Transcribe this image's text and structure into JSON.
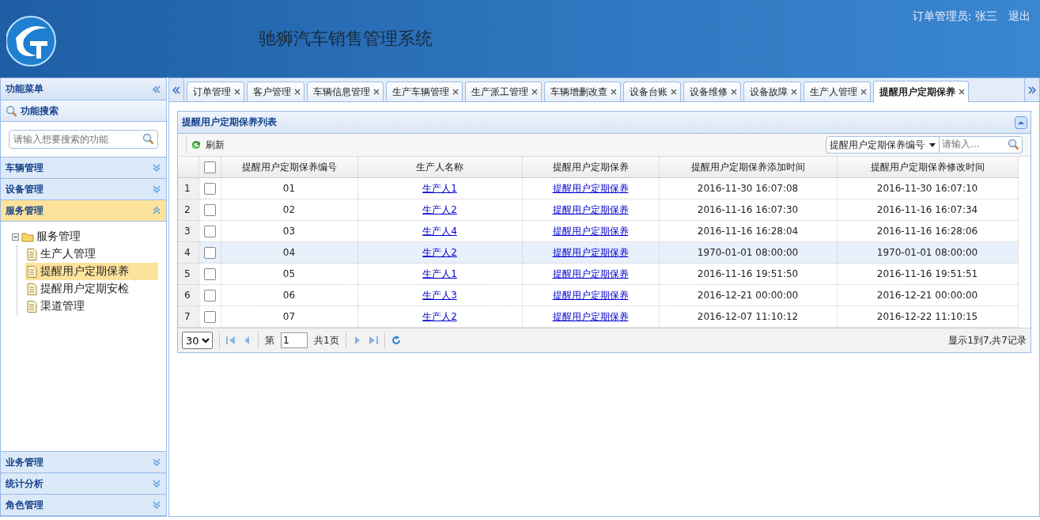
{
  "header": {
    "title": "驰狮汽车销售管理系统",
    "user": "订单管理员: 张三",
    "logout": "退出"
  },
  "sidebar": {
    "title": "功能菜单",
    "search_title": "功能搜索",
    "search": {
      "placeholder": "请输入想要搜索的功能"
    },
    "sections": [
      {
        "label": "车辆管理",
        "expanded": false
      },
      {
        "label": "设备管理",
        "expanded": false
      },
      {
        "label": "服务管理",
        "expanded": true,
        "tree": {
          "label": "服务管理",
          "expanded": true,
          "children": [
            {
              "label": "生产人管理",
              "selected": false
            },
            {
              "label": "提醒用户定期保养",
              "selected": true
            },
            {
              "label": "提醒用户定期安检",
              "selected": false
            },
            {
              "label": "渠道管理",
              "selected": false
            }
          ]
        }
      },
      {
        "label": "业务管理",
        "expanded": false
      },
      {
        "label": "统计分析",
        "expanded": false
      },
      {
        "label": "角色管理",
        "expanded": false
      }
    ]
  },
  "tabs": [
    {
      "label": "订单管理",
      "selected": false
    },
    {
      "label": "客户管理",
      "selected": false
    },
    {
      "label": "车辆信息管理",
      "selected": false
    },
    {
      "label": "生产车辆管理",
      "selected": false
    },
    {
      "label": "生产派工管理",
      "selected": false
    },
    {
      "label": "车辆增删改查",
      "selected": false
    },
    {
      "label": "设备台账",
      "selected": false
    },
    {
      "label": "设备维修",
      "selected": false
    },
    {
      "label": "设备故障",
      "selected": false
    },
    {
      "label": "生产人管理",
      "selected": false
    },
    {
      "label": "提醒用户定期保养",
      "selected": true
    }
  ],
  "panel": {
    "title": "提醒用户定期保养列表",
    "toolbar": {
      "refresh": "刷新",
      "search_field": "提醒用户定期保养编号",
      "search": {
        "placeholder": "请输入..."
      }
    },
    "table": {
      "columns": [
        {
          "label": "提醒用户定期保养编号",
          "kind": "text"
        },
        {
          "label": "生产人名称",
          "kind": "link"
        },
        {
          "label": "提醒用户定期保养",
          "kind": "link"
        },
        {
          "label": "提醒用户定期保养添加时间",
          "kind": "text"
        },
        {
          "label": "提醒用户定期保养修改时间",
          "kind": "text"
        }
      ],
      "header_checked": false,
      "rows": [
        {
          "number": "1",
          "selected": false,
          "checked": false,
          "cells": [
            "01",
            "生产人1",
            "提醒用户定期保养",
            "2016-11-30 16:07:08",
            "2016-11-30 16:07:10"
          ]
        },
        {
          "number": "2",
          "selected": false,
          "checked": false,
          "cells": [
            "02",
            "生产人2",
            "提醒用户定期保养",
            "2016-11-16 16:07:30",
            "2016-11-16 16:07:34"
          ]
        },
        {
          "number": "3",
          "selected": false,
          "checked": false,
          "cells": [
            "03",
            "生产人4",
            "提醒用户定期保养",
            "2016-11-16 16:28:04",
            "2016-11-16 16:28:06"
          ]
        },
        {
          "number": "4",
          "selected": true,
          "checked": false,
          "cells": [
            "04",
            "生产人2",
            "提醒用户定期保养",
            "1970-01-01 08:00:00",
            "1970-01-01 08:00:00"
          ]
        },
        {
          "number": "5",
          "selected": false,
          "checked": false,
          "cells": [
            "05",
            "生产人1",
            "提醒用户定期保养",
            "2016-11-16 19:51:50",
            "2016-11-16 19:51:51"
          ]
        },
        {
          "number": "6",
          "selected": false,
          "checked": false,
          "cells": [
            "06",
            "生产人3",
            "提醒用户定期保养",
            "2016-12-21 00:00:00",
            "2016-12-21 00:00:00"
          ]
        },
        {
          "number": "7",
          "selected": false,
          "checked": false,
          "cells": [
            "07",
            "生产人2",
            "提醒用户定期保养",
            "2016-12-07 11:10:12",
            "2016-12-22 11:10:15"
          ]
        }
      ]
    },
    "pager": {
      "page_size": "30",
      "page_label": "第",
      "page": "1",
      "total_pages": "共1页",
      "summary": "显示1到7,共7记录"
    }
  }
}
